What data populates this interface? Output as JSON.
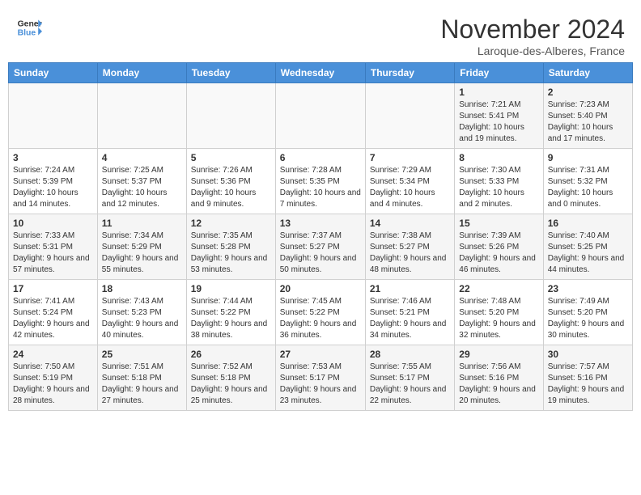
{
  "header": {
    "logo_general": "General",
    "logo_blue": "Blue",
    "title": "November 2024",
    "location": "Laroque-des-Alberes, France"
  },
  "weekdays": [
    "Sunday",
    "Monday",
    "Tuesday",
    "Wednesday",
    "Thursday",
    "Friday",
    "Saturday"
  ],
  "weeks": [
    [
      {
        "day": "",
        "info": ""
      },
      {
        "day": "",
        "info": ""
      },
      {
        "day": "",
        "info": ""
      },
      {
        "day": "",
        "info": ""
      },
      {
        "day": "",
        "info": ""
      },
      {
        "day": "1",
        "info": "Sunrise: 7:21 AM\nSunset: 5:41 PM\nDaylight: 10 hours and 19 minutes."
      },
      {
        "day": "2",
        "info": "Sunrise: 7:23 AM\nSunset: 5:40 PM\nDaylight: 10 hours and 17 minutes."
      }
    ],
    [
      {
        "day": "3",
        "info": "Sunrise: 7:24 AM\nSunset: 5:39 PM\nDaylight: 10 hours and 14 minutes."
      },
      {
        "day": "4",
        "info": "Sunrise: 7:25 AM\nSunset: 5:37 PM\nDaylight: 10 hours and 12 minutes."
      },
      {
        "day": "5",
        "info": "Sunrise: 7:26 AM\nSunset: 5:36 PM\nDaylight: 10 hours and 9 minutes."
      },
      {
        "day": "6",
        "info": "Sunrise: 7:28 AM\nSunset: 5:35 PM\nDaylight: 10 hours and 7 minutes."
      },
      {
        "day": "7",
        "info": "Sunrise: 7:29 AM\nSunset: 5:34 PM\nDaylight: 10 hours and 4 minutes."
      },
      {
        "day": "8",
        "info": "Sunrise: 7:30 AM\nSunset: 5:33 PM\nDaylight: 10 hours and 2 minutes."
      },
      {
        "day": "9",
        "info": "Sunrise: 7:31 AM\nSunset: 5:32 PM\nDaylight: 10 hours and 0 minutes."
      }
    ],
    [
      {
        "day": "10",
        "info": "Sunrise: 7:33 AM\nSunset: 5:31 PM\nDaylight: 9 hours and 57 minutes."
      },
      {
        "day": "11",
        "info": "Sunrise: 7:34 AM\nSunset: 5:29 PM\nDaylight: 9 hours and 55 minutes."
      },
      {
        "day": "12",
        "info": "Sunrise: 7:35 AM\nSunset: 5:28 PM\nDaylight: 9 hours and 53 minutes."
      },
      {
        "day": "13",
        "info": "Sunrise: 7:37 AM\nSunset: 5:27 PM\nDaylight: 9 hours and 50 minutes."
      },
      {
        "day": "14",
        "info": "Sunrise: 7:38 AM\nSunset: 5:27 PM\nDaylight: 9 hours and 48 minutes."
      },
      {
        "day": "15",
        "info": "Sunrise: 7:39 AM\nSunset: 5:26 PM\nDaylight: 9 hours and 46 minutes."
      },
      {
        "day": "16",
        "info": "Sunrise: 7:40 AM\nSunset: 5:25 PM\nDaylight: 9 hours and 44 minutes."
      }
    ],
    [
      {
        "day": "17",
        "info": "Sunrise: 7:41 AM\nSunset: 5:24 PM\nDaylight: 9 hours and 42 minutes."
      },
      {
        "day": "18",
        "info": "Sunrise: 7:43 AM\nSunset: 5:23 PM\nDaylight: 9 hours and 40 minutes."
      },
      {
        "day": "19",
        "info": "Sunrise: 7:44 AM\nSunset: 5:22 PM\nDaylight: 9 hours and 38 minutes."
      },
      {
        "day": "20",
        "info": "Sunrise: 7:45 AM\nSunset: 5:22 PM\nDaylight: 9 hours and 36 minutes."
      },
      {
        "day": "21",
        "info": "Sunrise: 7:46 AM\nSunset: 5:21 PM\nDaylight: 9 hours and 34 minutes."
      },
      {
        "day": "22",
        "info": "Sunrise: 7:48 AM\nSunset: 5:20 PM\nDaylight: 9 hours and 32 minutes."
      },
      {
        "day": "23",
        "info": "Sunrise: 7:49 AM\nSunset: 5:20 PM\nDaylight: 9 hours and 30 minutes."
      }
    ],
    [
      {
        "day": "24",
        "info": "Sunrise: 7:50 AM\nSunset: 5:19 PM\nDaylight: 9 hours and 28 minutes."
      },
      {
        "day": "25",
        "info": "Sunrise: 7:51 AM\nSunset: 5:18 PM\nDaylight: 9 hours and 27 minutes."
      },
      {
        "day": "26",
        "info": "Sunrise: 7:52 AM\nSunset: 5:18 PM\nDaylight: 9 hours and 25 minutes."
      },
      {
        "day": "27",
        "info": "Sunrise: 7:53 AM\nSunset: 5:17 PM\nDaylight: 9 hours and 23 minutes."
      },
      {
        "day": "28",
        "info": "Sunrise: 7:55 AM\nSunset: 5:17 PM\nDaylight: 9 hours and 22 minutes."
      },
      {
        "day": "29",
        "info": "Sunrise: 7:56 AM\nSunset: 5:16 PM\nDaylight: 9 hours and 20 minutes."
      },
      {
        "day": "30",
        "info": "Sunrise: 7:57 AM\nSunset: 5:16 PM\nDaylight: 9 hours and 19 minutes."
      }
    ]
  ]
}
